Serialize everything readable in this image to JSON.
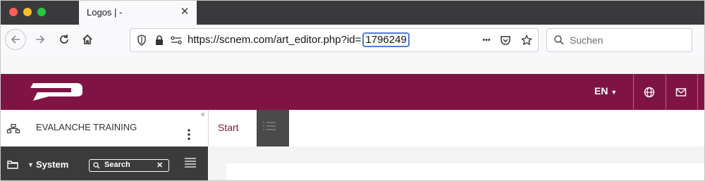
{
  "browser": {
    "tab": {
      "title": "Logos | -",
      "close_glyph": "✕"
    },
    "url": {
      "prefix": "https://scnem.com/art_editor.php?id=",
      "id": "1796249"
    },
    "search": {
      "placeholder": "Suchen"
    },
    "overflow_glyph": "•••"
  },
  "app": {
    "brand_color": "#7f1444",
    "header": {
      "language": "EN"
    },
    "sidebar": {
      "workspace_title": "EVALANCHE TRAINING",
      "system_label": "System",
      "search_label": "Search",
      "clear_glyph": "✕",
      "collapse_glyph": "«"
    },
    "tabs": [
      {
        "label": "Start"
      }
    ]
  }
}
